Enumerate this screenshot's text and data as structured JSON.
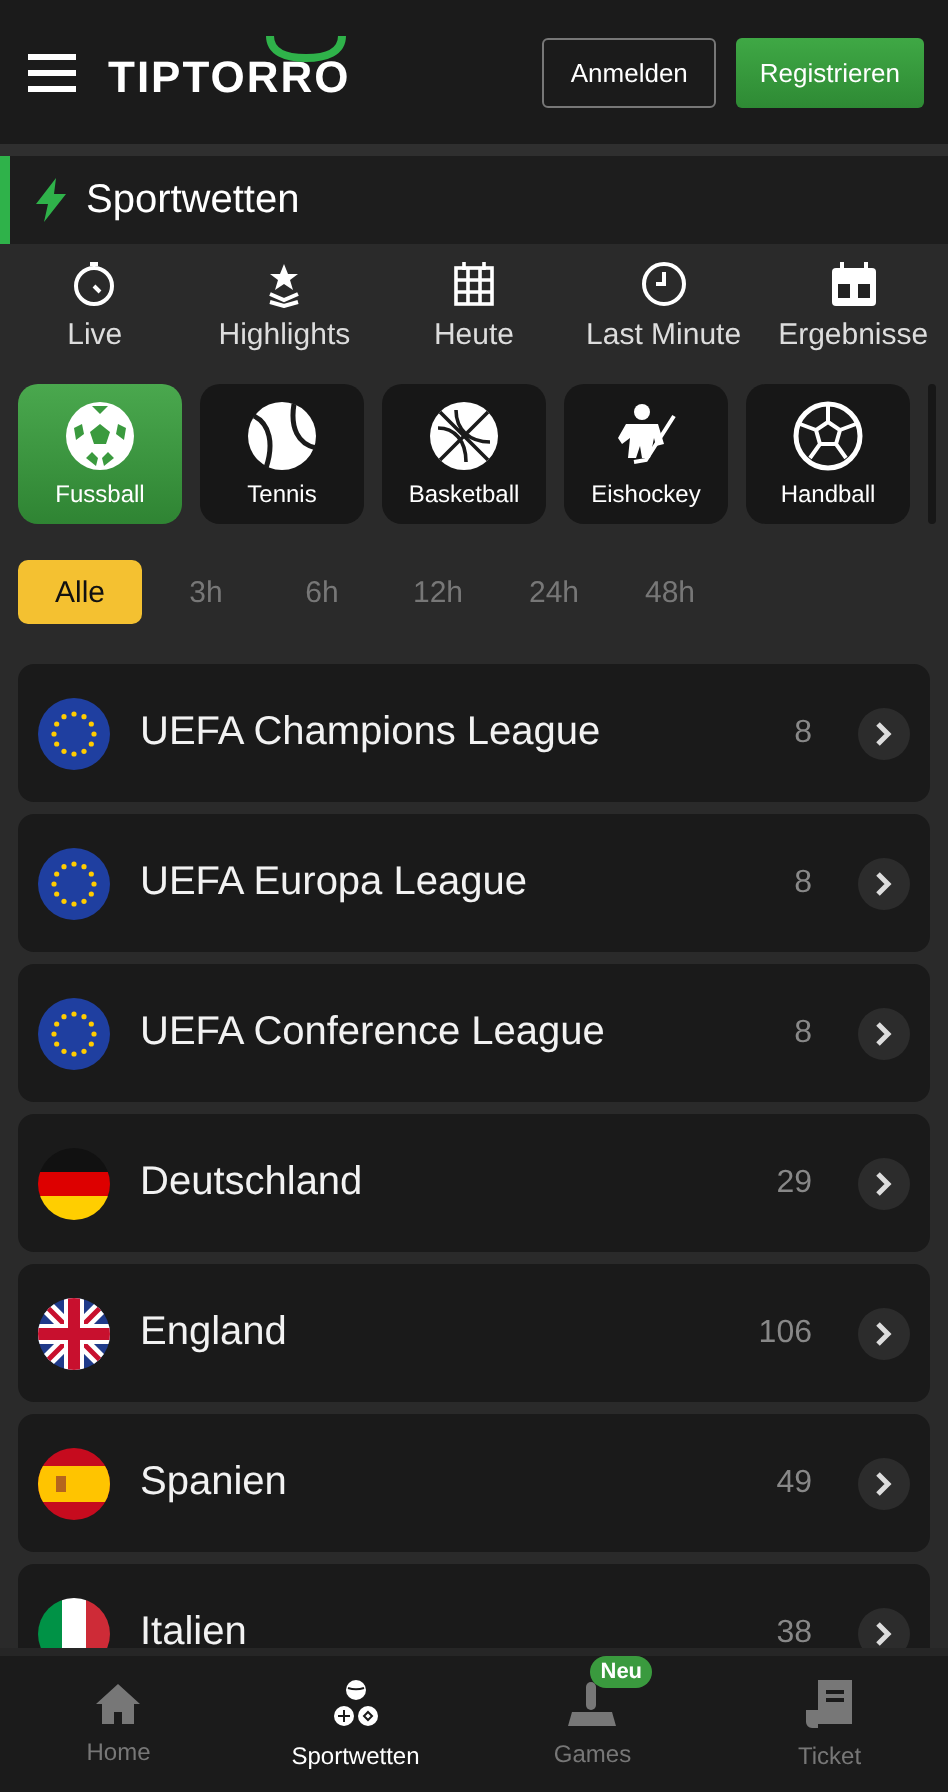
{
  "header": {
    "logo": "TIPTORRO",
    "login": "Anmelden",
    "register": "Registrieren"
  },
  "section": {
    "title": "Sportwetten"
  },
  "quick_links": [
    {
      "label": "Live",
      "kind": "stopwatch"
    },
    {
      "label": "Highlights",
      "kind": "star"
    },
    {
      "label": "Heute",
      "kind": "calendar"
    },
    {
      "label": "Last Minute",
      "kind": "clock"
    },
    {
      "label": "Ergebnisse",
      "kind": "score"
    }
  ],
  "sports": [
    {
      "label": "Fussball",
      "kind": "soccer",
      "selected": true
    },
    {
      "label": "Tennis",
      "kind": "tennis",
      "selected": false
    },
    {
      "label": "Basketball",
      "kind": "basketball",
      "selected": false
    },
    {
      "label": "Eishockey",
      "kind": "hockey",
      "selected": false
    },
    {
      "label": "Handball",
      "kind": "handball",
      "selected": false
    }
  ],
  "time_filters": [
    {
      "label": "Alle",
      "selected": true
    },
    {
      "label": "3h",
      "selected": false
    },
    {
      "label": "6h",
      "selected": false
    },
    {
      "label": "12h",
      "selected": false
    },
    {
      "label": "24h",
      "selected": false
    },
    {
      "label": "48h",
      "selected": false
    }
  ],
  "leagues": [
    {
      "name": "UEFA Champions League",
      "count": "8",
      "kind": "eu"
    },
    {
      "name": "UEFA Europa League",
      "count": "8",
      "kind": "eu"
    },
    {
      "name": "UEFA Conference League",
      "count": "8",
      "kind": "eu"
    },
    {
      "name": "Deutschland",
      "count": "29",
      "kind": "de"
    },
    {
      "name": "England",
      "count": "106",
      "kind": "gb"
    },
    {
      "name": "Spanien",
      "count": "49",
      "kind": "es"
    },
    {
      "name": "Italien",
      "count": "38",
      "kind": "it"
    }
  ],
  "bottom_nav": [
    {
      "label": "Home",
      "kind": "home",
      "selected": false
    },
    {
      "label": "Sportwetten",
      "kind": "sports",
      "selected": true
    },
    {
      "label": "Games",
      "kind": "joystick",
      "selected": false,
      "badge": "Neu"
    },
    {
      "label": "Ticket",
      "kind": "ticket",
      "selected": false
    }
  ]
}
